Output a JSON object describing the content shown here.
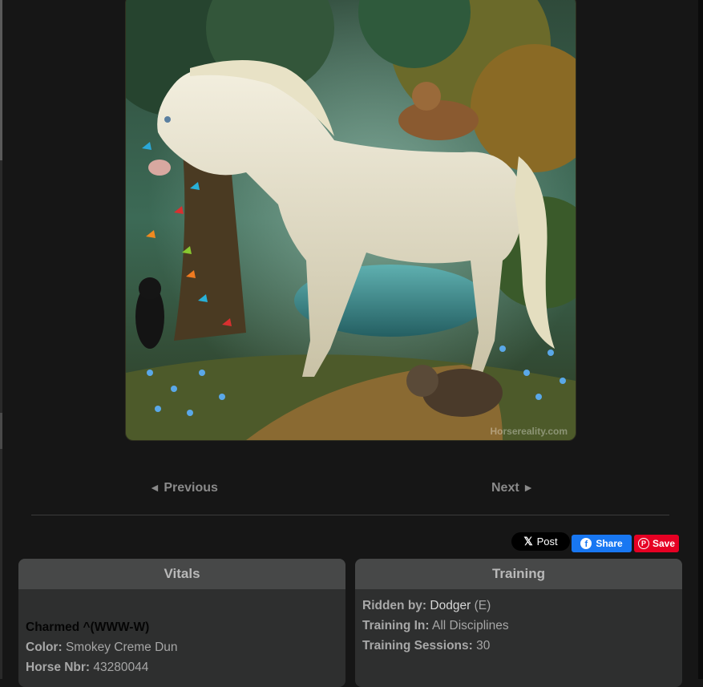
{
  "image": {
    "watermark": "Horsereality.com"
  },
  "navigation": {
    "previous_label": "Previous",
    "next_label": "Next",
    "previous_arrow": "◄",
    "next_arrow": "►"
  },
  "share": {
    "x_post_label": "Post",
    "x_icon": "x-logo-icon",
    "facebook_label": "Share",
    "facebook_icon": "facebook-icon",
    "pinterest_label": "Save",
    "pinterest_icon": "pinterest-icon"
  },
  "vitals": {
    "title": "Vitals",
    "horse_name": "Charmed ^(WWW-W)",
    "color_label": "Color:",
    "color_value": "Smokey Creme Dun",
    "number_label": "Horse Nbr:",
    "number_value": "43280044"
  },
  "training": {
    "title": "Training",
    "ridden_label": "Ridden by:",
    "ridden_value": "Dodger",
    "ridden_suffix": "(E)",
    "training_in_label": "Training In:",
    "training_in_value": "All Disciplines",
    "sessions_label": "Training Sessions:",
    "sessions_value": "30"
  },
  "colors": {
    "background": "#161616",
    "panel": "#2e2f2f",
    "panel_header": "#474848",
    "facebook": "#1877f2",
    "pinterest": "#e60023"
  }
}
